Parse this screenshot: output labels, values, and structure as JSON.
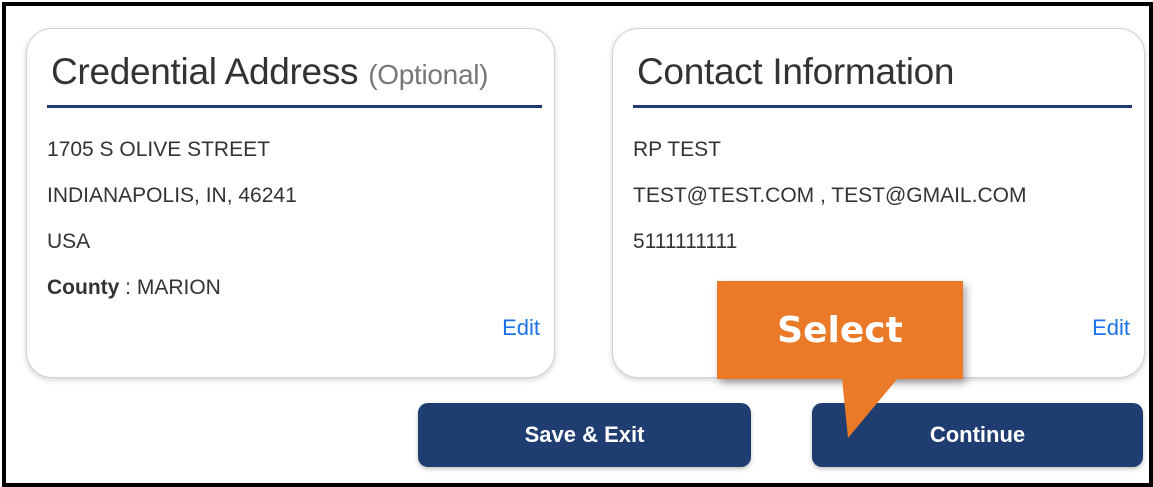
{
  "credential_card": {
    "title": "Credential Address",
    "title_suffix": "(Optional)",
    "address_line1": "1705 S OLIVE STREET",
    "address_line2": "INDIANAPOLIS, IN, 46241",
    "country": "USA",
    "county_label": "County",
    "county_value": " : MARION",
    "edit_label": "Edit"
  },
  "contact_card": {
    "title": "Contact Information",
    "name": "RP TEST",
    "emails": "TEST@TEST.COM , TEST@GMAIL.COM",
    "phone": "5111111111",
    "edit_label": "Edit"
  },
  "actions": {
    "save_exit_label": "Save & Exit",
    "continue_label": "Continue"
  },
  "callout": {
    "label": "Select",
    "color": "#ea7a27"
  },
  "colors": {
    "primary_button": "#1f3d70",
    "title_rule": "#1e3a6e",
    "link": "#1a73e8"
  }
}
